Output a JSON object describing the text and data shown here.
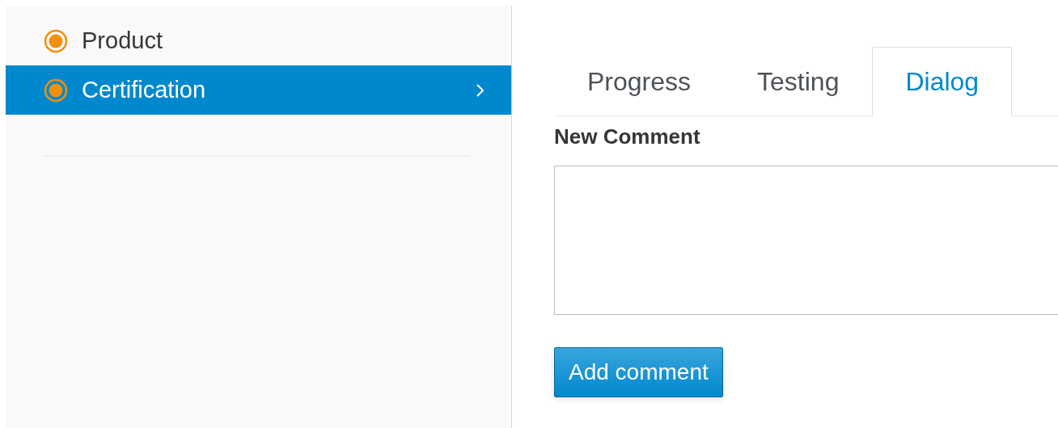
{
  "sidebar": {
    "items": [
      {
        "label": "Product",
        "selected": false
      },
      {
        "label": "Certification",
        "selected": true
      }
    ]
  },
  "tabs": [
    {
      "label": "Progress",
      "selected": false
    },
    {
      "label": "Testing",
      "selected": false
    },
    {
      "label": "Dialog",
      "selected": true
    }
  ],
  "comment_form": {
    "label": "New Comment",
    "button": "Add comment"
  }
}
